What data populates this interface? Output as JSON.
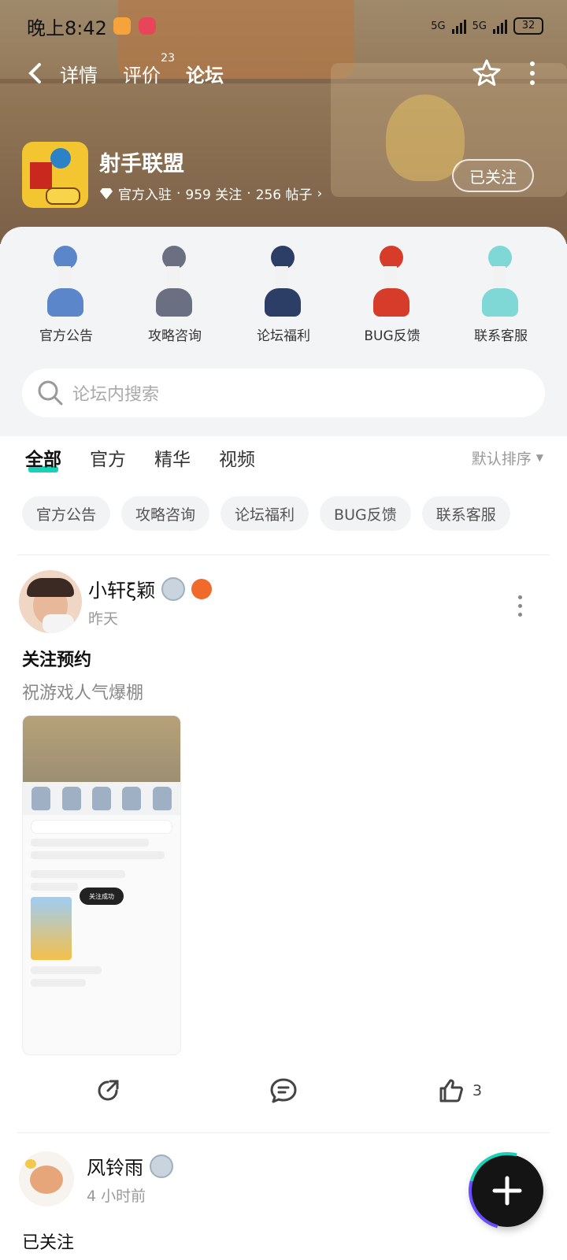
{
  "statusbar": {
    "time": "晚上8:42",
    "net1": "5G",
    "net2": "5G",
    "battery": "32"
  },
  "nav": {
    "tabs": [
      {
        "label": "详情"
      },
      {
        "label": "评价",
        "count": "23"
      },
      {
        "label": "论坛"
      }
    ]
  },
  "game": {
    "name": "射手联盟",
    "official": "官方入驻",
    "follows": "959 关注",
    "posts": "256 帖子",
    "follow_btn": "已关注"
  },
  "categories": [
    {
      "label": "官方公告",
      "color": "#5b86c9"
    },
    {
      "label": "攻略咨询",
      "color": "#6b6f82"
    },
    {
      "label": "论坛福利",
      "color": "#2c3d66"
    },
    {
      "label": "BUG反馈",
      "color": "#d73b2a"
    },
    {
      "label": "联系客服",
      "color": "#7fd8d6"
    }
  ],
  "search": {
    "placeholder": "论坛内搜索"
  },
  "filters": {
    "tabs": [
      "全部",
      "官方",
      "精华",
      "视频"
    ],
    "sort": "默认排序"
  },
  "chips": [
    "官方公告",
    "攻略咨询",
    "论坛福利",
    "BUG反馈",
    "联系客服"
  ],
  "posts": [
    {
      "user": "小轩ξ颖",
      "time": "昨天",
      "title": "关注预约",
      "body": "祝游戏人气爆棚",
      "likes": "3",
      "shot_toast": "关注成功"
    },
    {
      "user": "风铃雨",
      "time": "4 小时前",
      "title": "已关注"
    }
  ],
  "colors": {
    "accent": "#19d0b8"
  }
}
